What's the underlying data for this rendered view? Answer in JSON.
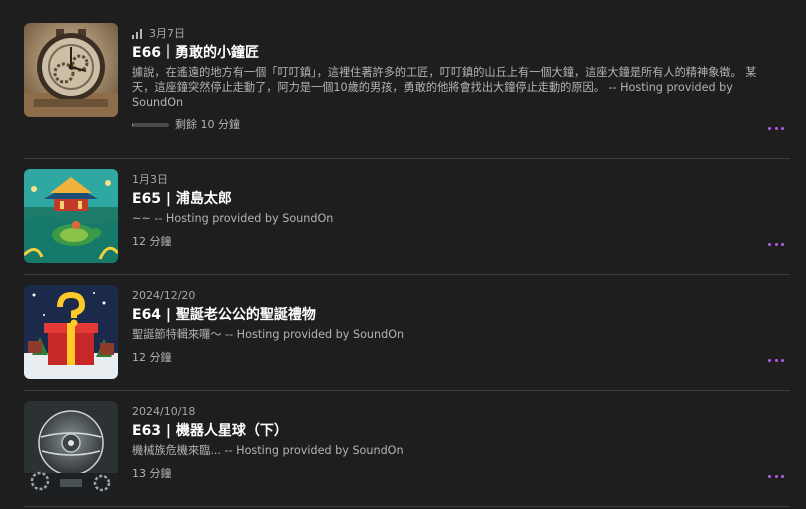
{
  "episodes": [
    {
      "date": "3月7日",
      "title": "E66｜勇敢的小鐘匠",
      "description": "據說，在遙遠的地方有一個「叮叮鎮」，這裡住著許多的工匠，叮叮鎮的山丘上有一個大鐘，這座大鐘是所有人的精神象徵。 某天，這座鐘突然停止走動了，阿力是一個10歲的男孩，勇敢的他將會找出大鐘停止走動的原因。 -- Hosting provided by SoundOn",
      "duration": "剩餘 10 分鐘",
      "progress_fraction": 0.03,
      "status_icon": "signal-bars-icon"
    },
    {
      "date": "1月3日",
      "title": "E65 | 浦島太郎",
      "description": "~~ -- Hosting provided by SoundOn",
      "duration": "12 分鐘"
    },
    {
      "date": "2024/12/20",
      "title": "E64 | 聖誕老公公的聖誕禮物",
      "description": "聖誕節特輯來囉～ -- Hosting provided by SoundOn",
      "duration": "12 分鐘"
    },
    {
      "date": "2024/10/18",
      "title": "E63 | 機器人星球（下）",
      "description": "機械族危機來臨... -- Hosting provided by SoundOn",
      "duration": "13 分鐘"
    }
  ],
  "icons": {
    "more": "more-options-icon"
  },
  "colors": {
    "accent": "#b45df0",
    "background": "#1e1e1e",
    "divider": "#3a3a3a"
  }
}
